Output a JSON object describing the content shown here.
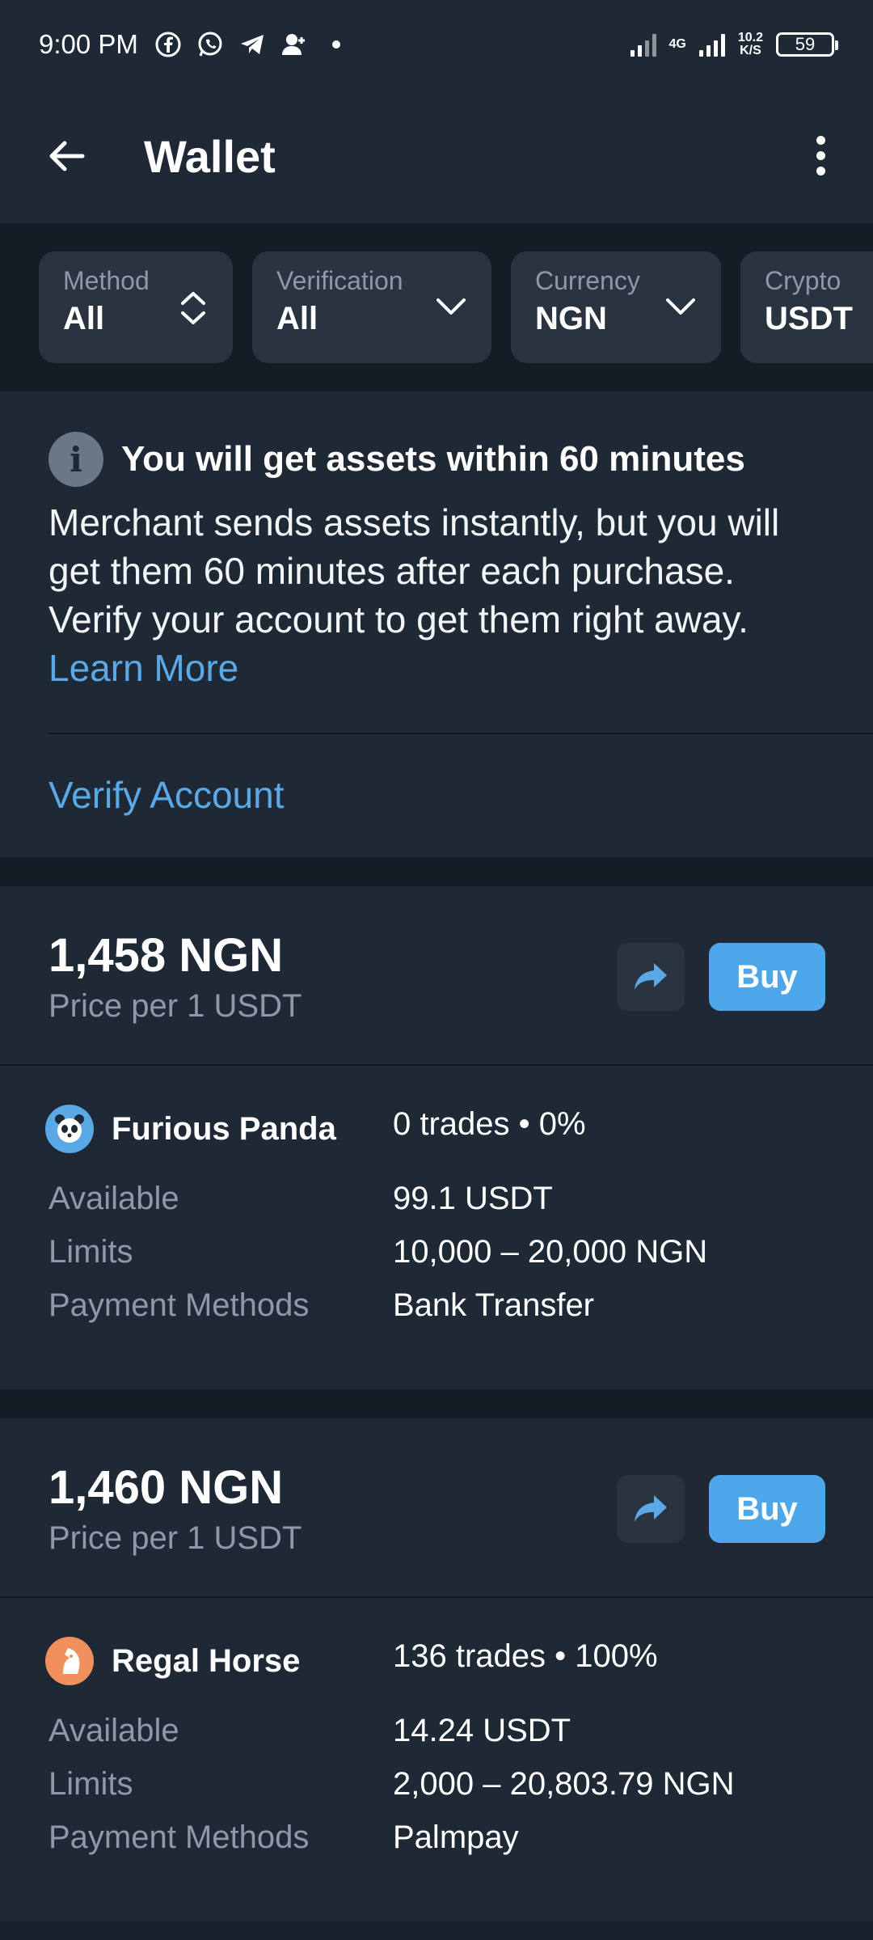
{
  "status_bar": {
    "time": "9:00 PM",
    "icons": [
      "facebook-icon",
      "whatsapp-icon",
      "telegram-icon",
      "person-add-icon",
      "dot-icon"
    ],
    "network_type": "4G",
    "net_speed_value": "10.2",
    "net_speed_unit": "K/S",
    "battery": "59"
  },
  "app_bar": {
    "title": "Wallet",
    "back_icon": "arrow-left-icon",
    "menu_icon": "more-vert-icon"
  },
  "filters": [
    {
      "label": "Method",
      "value": "All",
      "icon": "sort-updown-icon"
    },
    {
      "label": "Verification",
      "value": "All",
      "icon": "chevron-down-icon"
    },
    {
      "label": "Currency",
      "value": "NGN",
      "icon": "chevron-down-icon"
    },
    {
      "label": "Crypto",
      "value": "USDT",
      "icon": "chevron-down-icon"
    }
  ],
  "notice": {
    "title": "You will get assets within 60 minutes",
    "body": "Merchant sends assets instantly, but you will get them 60 minutes after each purchase. Verify your account to get them right away.",
    "learn_more": "Learn More",
    "verify": "Verify Account"
  },
  "offers": [
    {
      "price": "1,458 NGN",
      "price_sub": "Price per 1 USDT",
      "buy_label": "Buy",
      "merchant": "Furious Panda",
      "avatar_icon": "panda-icon",
      "avatar_color": "#5aa9e6",
      "trades": "0 trades • 0%",
      "available_label": "Available",
      "available": "99.1 USDT",
      "limits_label": "Limits",
      "limits": "10,000 – 20,000 NGN",
      "payment_label": "Payment Methods",
      "payment": "Bank Transfer"
    },
    {
      "price": "1,460 NGN",
      "price_sub": "Price per 1 USDT",
      "buy_label": "Buy",
      "merchant": "Regal Horse",
      "avatar_icon": "horse-icon",
      "avatar_color": "#f0905c",
      "trades": "136 trades • 100%",
      "available_label": "Available",
      "available": "14.24 USDT",
      "limits_label": "Limits",
      "limits": "2,000 – 20,803.79 NGN",
      "payment_label": "Payment Methods",
      "payment": "Palmpay"
    }
  ],
  "colors": {
    "background": "#17212b",
    "card": "#1f2936",
    "accent": "#4ea7ea",
    "muted_text": "#8d99a6"
  }
}
